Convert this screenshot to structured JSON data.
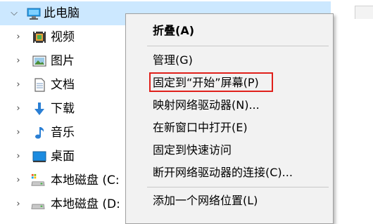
{
  "tree": {
    "items": [
      {
        "label": "此电脑",
        "expanded": true,
        "selected": true,
        "icon": "computer-icon"
      },
      {
        "label": "视频",
        "icon": "video-folder-icon"
      },
      {
        "label": "图片",
        "icon": "pictures-folder-icon"
      },
      {
        "label": "文档",
        "icon": "documents-folder-icon"
      },
      {
        "label": "下载",
        "icon": "downloads-icon"
      },
      {
        "label": "音乐",
        "icon": "music-icon"
      },
      {
        "label": "桌面",
        "icon": "desktop-icon"
      },
      {
        "label": "本地磁盘 (C:",
        "icon": "drive-c-icon"
      },
      {
        "label": "本地磁盘 (D:",
        "icon": "drive-d-icon"
      }
    ]
  },
  "menu": {
    "items": [
      {
        "label": "折叠(A)",
        "bold": true
      },
      {
        "label": "管理(G)"
      },
      {
        "label": "固定到“开始”屏幕(P)",
        "highlighted": true
      },
      {
        "label": "映射网络驱动器(N)..."
      },
      {
        "label": "在新窗口中打开(E)"
      },
      {
        "label": "固定到快速访问"
      },
      {
        "label": "断开网络驱动器的连接(C)..."
      },
      {
        "label": "添加一个网络位置(L)"
      }
    ]
  },
  "colors": {
    "selection": "#cce8ff",
    "menu_background": "#f2f2f2",
    "highlight_border": "#e0201b"
  }
}
